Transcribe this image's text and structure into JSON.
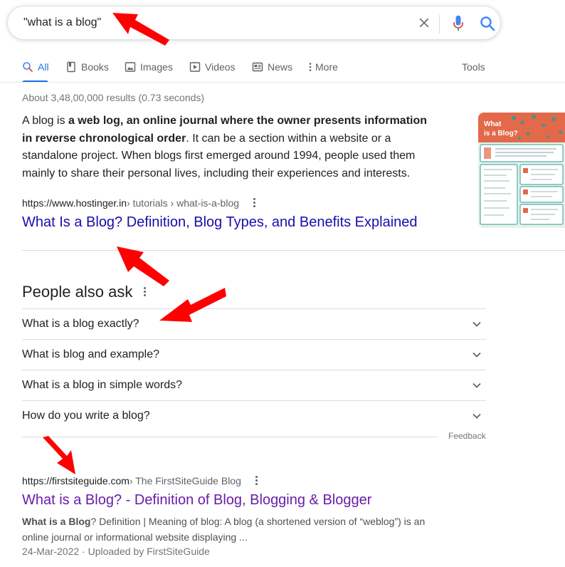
{
  "search": {
    "query": "\"what is a blog\"",
    "clear_icon": "close-icon",
    "mic_icon": "microphone-icon",
    "search_icon": "search-icon"
  },
  "tabs": [
    {
      "label": "All",
      "icon": "search-icon",
      "active": true
    },
    {
      "label": "Books",
      "icon": "book-icon"
    },
    {
      "label": "Images",
      "icon": "image-icon"
    },
    {
      "label": "Videos",
      "icon": "video-icon"
    },
    {
      "label": "News",
      "icon": "news-icon"
    },
    {
      "label": "More",
      "icon": "more-vert-icon"
    }
  ],
  "tools_label": "Tools",
  "result_stats": "About 3,48,00,000 results (0.73 seconds)",
  "featured_snippet": {
    "text_before": "A blog is ",
    "bold_text": "a web log, an online journal where the owner presents information in reverse chronological order",
    "text_after": ". It can be a section within a website or a standalone project. When blogs first emerged around 1994, people used them mainly to share their personal lives, including their experiences and interests.",
    "thumbnail_title": "What is a Blog?",
    "source_domain": "https://www.hostinger.in",
    "source_path": " › tutorials › what-is-a-blog",
    "title": "What Is a Blog? Definition, Blog Types, and Benefits Explained"
  },
  "people_also_ask": {
    "title": "People also ask",
    "questions": [
      "What is a blog exactly?",
      "What is blog and example?",
      "What is a blog in simple words?",
      "How do you write a blog?"
    ],
    "feedback_label": "Feedback"
  },
  "result2": {
    "source_domain": "https://firstsiteguide.com",
    "source_path": " › The FirstSiteGuide Blog",
    "title": "What is a Blog? - Definition of Blog, Blogging & Blogger",
    "desc_bold": "What is a Blog",
    "desc_rest": "? Definition | Meaning of blog: A blog (a shortened version of “weblog”) is an online journal or informational website displaying ...",
    "date_line": "24-Mar-2022 · Uploaded by FirstSiteGuide"
  },
  "colors": {
    "link": "#1a0dab",
    "visited_link": "#681da8",
    "accent": "#1a73e8",
    "annotation_arrow": "#ff0000"
  }
}
